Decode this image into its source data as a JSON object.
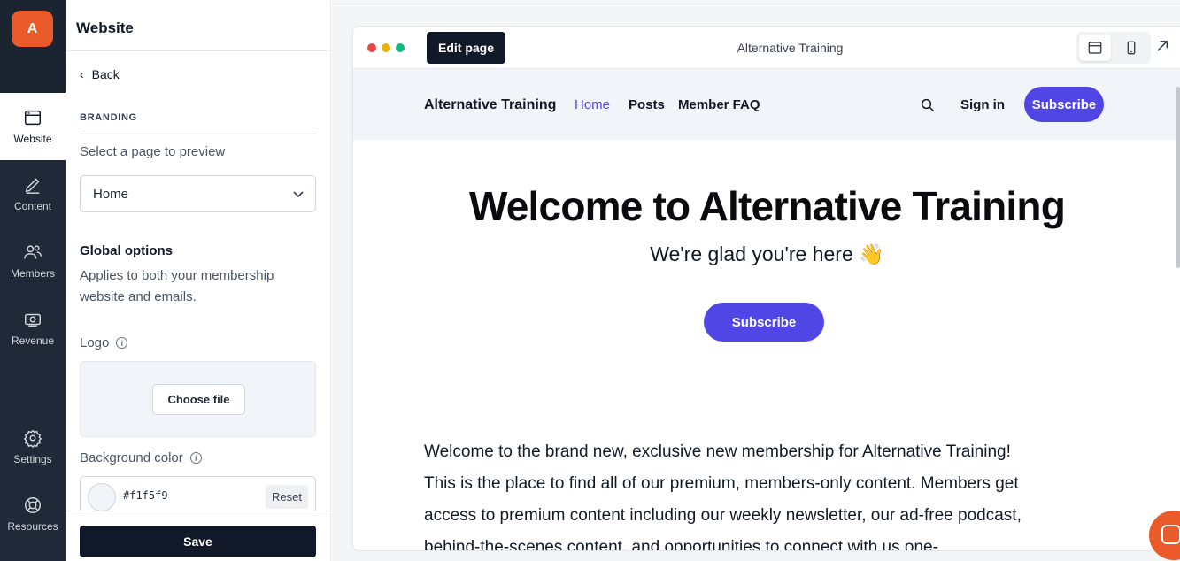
{
  "rail": {
    "logo_letter": "A",
    "items": [
      {
        "label": "Website",
        "icon": "browser-window-icon"
      },
      {
        "label": "Content",
        "icon": "pencil-icon"
      },
      {
        "label": "Members",
        "icon": "users-icon"
      },
      {
        "label": "Revenue",
        "icon": "money-icon"
      },
      {
        "label": "Settings",
        "icon": "gear-icon"
      },
      {
        "label": "Resources",
        "icon": "lifebuoy-icon"
      }
    ]
  },
  "panel": {
    "title": "Website",
    "back_label": "Back",
    "section_label": "BRANDING",
    "preview_label": "Select a page to preview",
    "page_select_value": "Home",
    "global_title": "Global options",
    "global_desc": "Applies to both your membership website and emails.",
    "logo_label": "Logo",
    "choose_file_label": "Choose file",
    "bg_color_label": "Background color",
    "bg_color_hex": "#f1f5f9",
    "reset_label": "Reset",
    "save_label": "Save"
  },
  "browser": {
    "edit_page_label": "Edit page",
    "title": "Alternative Training",
    "dot_colors": [
      "#ef4444",
      "#eab308",
      "#10b981"
    ]
  },
  "site": {
    "brand": "Alternative Training",
    "nav": [
      "Home",
      "Posts",
      "Member FAQ"
    ],
    "active_nav": "Home",
    "signin_label": "Sign in",
    "subscribe_label": "Subscribe",
    "hero_title": "Welcome to Alternative Training",
    "hero_subtitle": "We're glad you're here 👋",
    "hero_button": "Subscribe",
    "body_text": "Welcome to the brand new, exclusive new membership for Alternative Training! This is the place to find all of our premium, members-only content. Members get access to premium content including our weekly newsletter, our ad-free podcast, behind-the-scenes content, and opportunities to connect with us one-"
  },
  "colors": {
    "accent": "#4f46e5",
    "brand": "#ea5a2b",
    "rail_bg": "#1f2937"
  }
}
